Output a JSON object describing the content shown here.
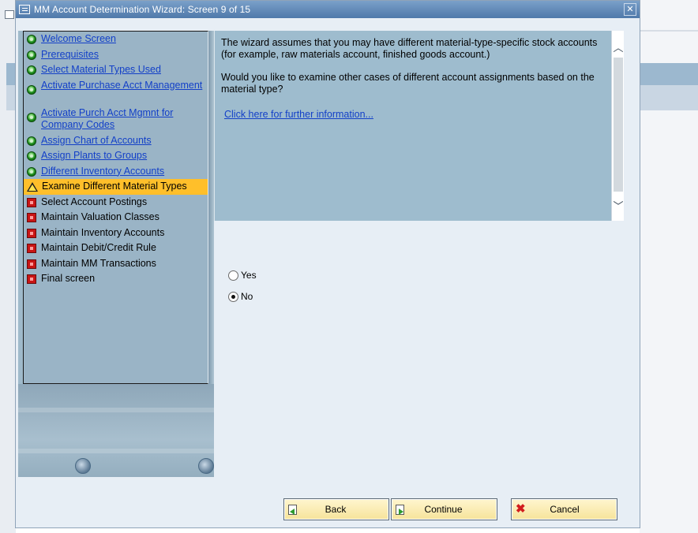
{
  "dialog": {
    "title": "MM Account Determination Wizard: Screen 9 of 15",
    "close_glyph": "✕"
  },
  "steps": [
    {
      "label": "Welcome Screen",
      "status": "done"
    },
    {
      "label": "Prerequisites",
      "status": "done"
    },
    {
      "label": "Select Material Types Used",
      "status": "done"
    },
    {
      "label": "Activate Purchase Acct Management",
      "status": "done"
    },
    {
      "label": "Activate Purch Acct Mgmnt for Company Codes",
      "status": "done"
    },
    {
      "label": "Assign Chart of Accounts",
      "status": "done"
    },
    {
      "label": "Assign Plants to Groups",
      "status": "done"
    },
    {
      "label": "Different Inventory Accounts",
      "status": "done"
    },
    {
      "label": "Examine Different Material Types",
      "status": "current"
    },
    {
      "label": "Select Account Postings",
      "status": "todo"
    },
    {
      "label": "Maintain Valuation Classes",
      "status": "todo"
    },
    {
      "label": "Maintain Inventory Accounts",
      "status": "todo"
    },
    {
      "label": "Maintain Debit/Credit Rule",
      "status": "todo"
    },
    {
      "label": "Maintain MM Transactions",
      "status": "todo"
    },
    {
      "label": "Final screen",
      "status": "todo"
    }
  ],
  "info": {
    "paragraph1": "The wizard assumes that you may have different material-type-specific stock accounts (for example, raw materials account, finished goods account.)",
    "paragraph2": "Would you like to examine other cases of different account assignments based on the material type?",
    "link": "Click here for further information..."
  },
  "options": {
    "yes_label": "Yes",
    "no_label": "No",
    "selected": "No"
  },
  "buttons": {
    "back": "Back",
    "continue": "Continue",
    "cancel": "Cancel"
  },
  "colors": {
    "title_bar": "#5d85b3",
    "nav_background": "#9ab4c6",
    "current_step_highlight": "#ffbf2a",
    "link": "#1340c8",
    "button": "#f6e39a"
  }
}
